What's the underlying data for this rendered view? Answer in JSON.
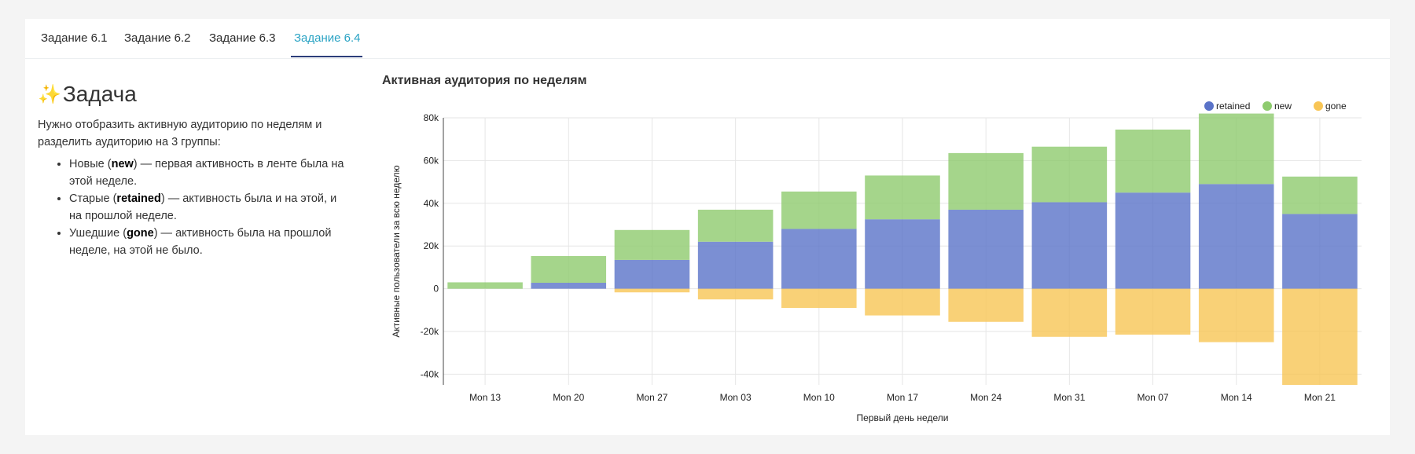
{
  "tabs": [
    {
      "label": "Задание 6.1",
      "active": false
    },
    {
      "label": "Задание 6.2",
      "active": false
    },
    {
      "label": "Задание 6.3",
      "active": false
    },
    {
      "label": "Задание 6.4",
      "active": true
    }
  ],
  "task": {
    "icon": "sparkles-icon",
    "heading": "Задача",
    "intro": "Нужно отобразить активную аудиторию по неделям и разделить аудиторию на 3 группы:",
    "items": [
      {
        "prefix": "Новые (",
        "keyword": "new",
        "suffix": ") — первая активность в ленте была на этой неделе."
      },
      {
        "prefix": "Старые (",
        "keyword": "retained",
        "suffix": ") — активность была и на этой, и на прошлой неделе."
      },
      {
        "prefix": "Ушедшие (",
        "keyword": "gone",
        "suffix": ") — активность была на прошлой неделе, на этой не было."
      }
    ]
  },
  "chart_data": {
    "type": "bar",
    "stacked": true,
    "title": "Активная аудитория по неделям",
    "xlabel": "Первый день недели",
    "ylabel": "Активные пользователи за всю неделю",
    "ylim": [
      -45000,
      80000
    ],
    "yticks": [
      80000,
      60000,
      40000,
      20000,
      0,
      -20000,
      -40000
    ],
    "ytick_labels": [
      "80k",
      "60k",
      "40k",
      "20k",
      "0",
      "-20k",
      "-40k"
    ],
    "categories": [
      "Mon 13",
      "Mon 20",
      "Mon 27",
      "Mon 03",
      "Mon 10",
      "Mon 17",
      "Mon 24",
      "Mon 31",
      "Mon 07",
      "Mon 14",
      "Mon 21"
    ],
    "legend_position": "top-right",
    "grid": true,
    "series": [
      {
        "name": "retained",
        "color": "#5a73c8",
        "values": [
          0,
          2800,
          13500,
          22000,
          28000,
          32500,
          37000,
          40500,
          45000,
          49000,
          35000
        ]
      },
      {
        "name": "new",
        "color": "#8ecb6e",
        "values": [
          3000,
          12500,
          14000,
          15000,
          17500,
          20500,
          26500,
          26000,
          29500,
          33000,
          17500
        ]
      },
      {
        "name": "gone",
        "color": "#f8c555",
        "values": [
          0,
          0,
          -1700,
          -5000,
          -9000,
          -12500,
          -15500,
          -22500,
          -21500,
          -25000,
          -45000
        ]
      }
    ]
  }
}
